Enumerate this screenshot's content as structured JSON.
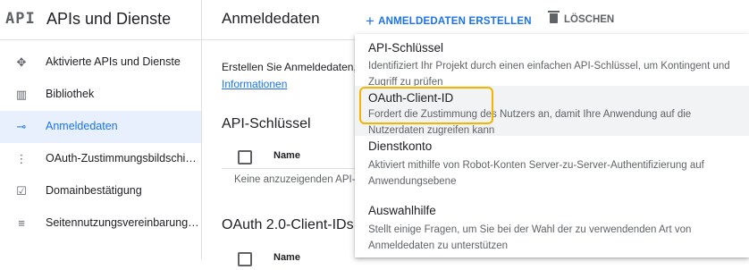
{
  "sidebar": {
    "brand_icon": "API",
    "brand_title": "APIs und Dienste",
    "items": [
      {
        "label": "Aktivierte APIs und Dienste",
        "icon": "diamond-arrows-icon",
        "glyph": "✥"
      },
      {
        "label": "Bibliothek",
        "icon": "library-grid-icon",
        "glyph": "▥"
      },
      {
        "label": "Anmeldedaten",
        "icon": "key-icon",
        "glyph": "⊸",
        "active": true
      },
      {
        "label": "OAuth-Zustimmungsbildschi…",
        "icon": "consent-screen-icon",
        "glyph": "⋮"
      },
      {
        "label": "Domainbestätigung",
        "icon": "checkbox-icon",
        "glyph": "☑"
      },
      {
        "label": "Seitennutzungsvereinbarung…",
        "icon": "settings-list-icon",
        "glyph": "≡"
      }
    ]
  },
  "header": {
    "title": "Anmeldedaten",
    "create_label": "ANMELDEDATEN ERSTELLEN",
    "delete_label": "LÖSCHEN"
  },
  "main": {
    "intro_text": "Erstellen Sie Anmeldedaten,",
    "intro_link": "Informationen",
    "api_keys_heading": "API-Schlüssel",
    "column_name": "Name",
    "empty_text": "Keine anzuzeigenden API-",
    "oauth_heading": "OAuth 2.0-Client-IDs",
    "column_name_2": "Name"
  },
  "menu": {
    "items": [
      {
        "title": "API-Schlüssel",
        "description": "Identifiziert Ihr Projekt durch einen einfachen API-Schlüssel, um Kontingent und Zugriff zu prüfen"
      },
      {
        "title": "OAuth-Client-ID",
        "description": "Fordert die Zustimmung des Nutzers an, damit Ihre Anwendung auf die Nutzerdaten zugreifen kann"
      },
      {
        "title": "Dienstkonto",
        "description": "Aktiviert mithilfe von Robot-Konten Server-zu-Server-Authentifizierung auf Anwendungsebene"
      },
      {
        "title": "Auswahlhilfe",
        "description": "Stellt einige Fragen, um Sie bei der Wahl der zu verwendenden Art von Anmeldedaten zu unterstützen"
      }
    ]
  },
  "colors": {
    "accent": "#1a73e8",
    "active_bg": "#e8f0fe",
    "highlight": "#f4b400"
  }
}
